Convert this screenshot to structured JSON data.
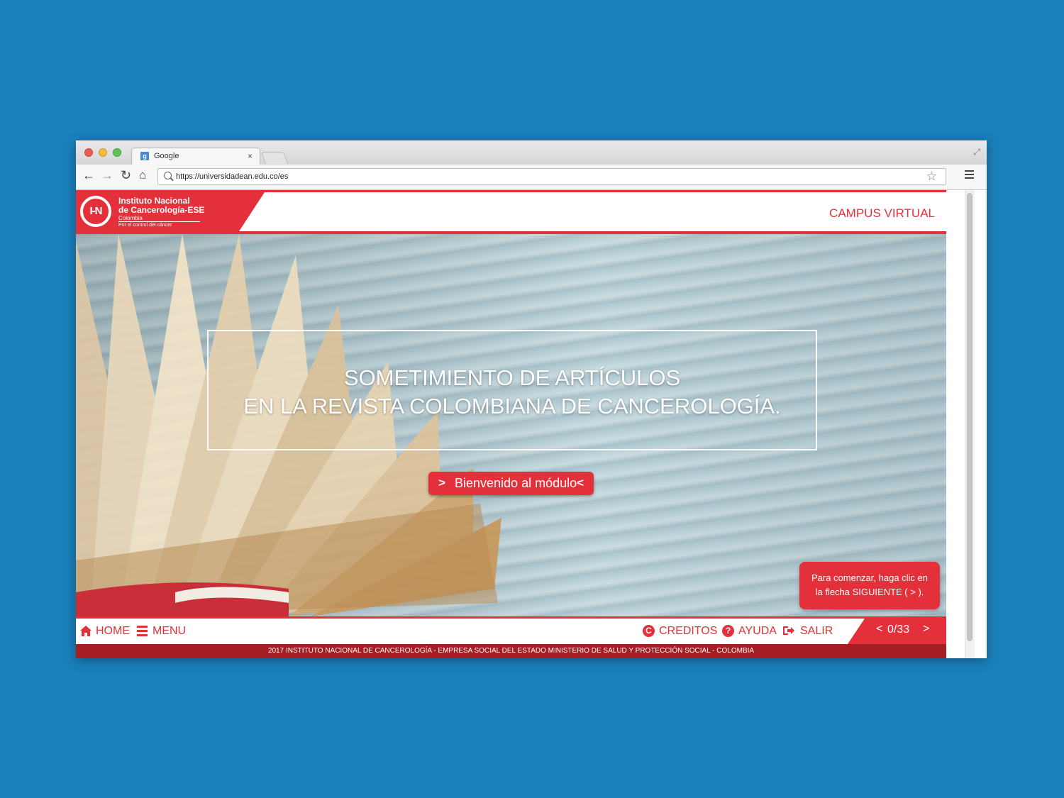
{
  "browser": {
    "tab_title": "Google",
    "tab_favicon": "g",
    "tab_close": "×",
    "url": "https://universidadean.edu.co/es",
    "icons": {
      "back": "back-arrow-icon",
      "forward": "forward-arrow-icon",
      "reload": "reload-icon",
      "home": "home-icon",
      "star": "star-icon",
      "menu": "hamburger-menu-icon",
      "resize": "fullscreen-icon"
    }
  },
  "header": {
    "logo_mark": "I-N",
    "logo_line1": "Instituto Nacional",
    "logo_line2": "de Cancerología-ESE",
    "logo_line3": "Colombia",
    "logo_line4": "Por el control del cáncer",
    "campus_label": "CAMPUS VIRTUAL"
  },
  "hero": {
    "title_line1": "SOMETIMIENTO DE ARTÍCULOS",
    "title_line2": "EN LA REVISTA COLOMBIANA DE CANCEROLOGÍA.",
    "welcome_left_arrow": ">",
    "welcome_label": "Bienvenido al módulo",
    "welcome_right_arrow": "<",
    "hint_line1": "Para comenzar, haga clic en",
    "hint_line2": "la flecha SIGUIENTE ( > )."
  },
  "footer_nav": {
    "home_label": "HOME",
    "menu_label": "MENU",
    "creditos_label": "CREDITOS",
    "ayuda_label": "AYUDA",
    "salir_label": "SALIR",
    "pager_prev": "<",
    "pager_count": "0/33",
    "pager_next": ">"
  },
  "footer_bar": {
    "text": "2017 INSTITUTO NACIONAL DE CANCEROLOGÍA - EMPRESA SOCIAL DEL ESTADO MINISTERIO DE SALUD Y PROTECCIÓN SOCIAL - COLOMBIA"
  },
  "colors": {
    "background": "#1a80bb",
    "brand_red": "#e3303a",
    "footer_dark_red": "#a41e24"
  }
}
